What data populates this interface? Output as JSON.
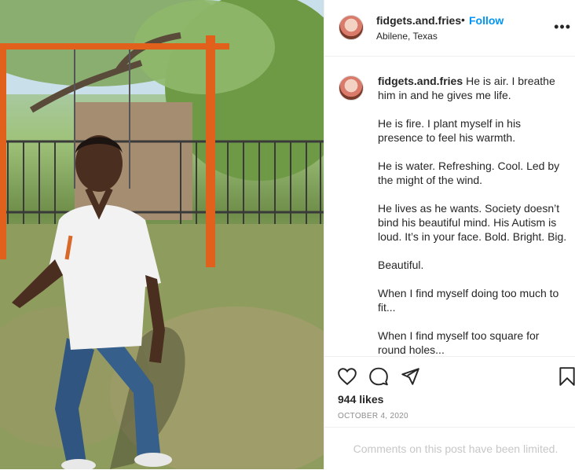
{
  "post": {
    "username": "fidgets.and.fries",
    "dot": "•",
    "follow_label": "Follow",
    "location": "Abilene, Texas",
    "more_label": "•••",
    "caption_paragraphs": [
      "He is air. I breathe him in and he gives me life.",
      "He is fire. I plant myself in his presence to feel his warmth.",
      "He is water. Refreshing. Cool. Led by the might of the wind.",
      "He lives as he wants. Society doesn’t bind his beautiful mind. His Autism is loud. It’s in your face. Bold. Bright. Big.",
      "Beautiful.",
      "When I find myself doing too much to fit...",
      "When I find myself too square for round holes..."
    ],
    "likes": "944 likes",
    "date": "OCTOBER 4, 2020",
    "comments_limited": "Comments on this post have been limited."
  },
  "icons": {
    "like": "heart-icon",
    "comment": "comment-icon",
    "share": "share-icon",
    "save": "bookmark-icon"
  },
  "colors": {
    "accent": "#0095f6",
    "text": "#262626",
    "muted": "#8e8e8e"
  }
}
